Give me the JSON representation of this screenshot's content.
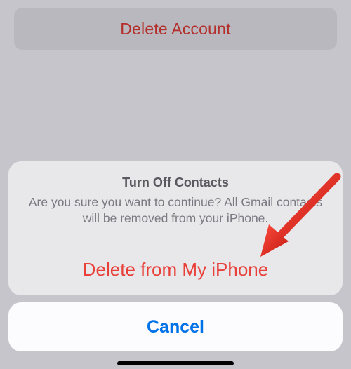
{
  "delete_account_label": "Delete Account",
  "sheet": {
    "title": "Turn Off Contacts",
    "message": "Are you sure you want to continue? All Gmail contacts will be removed from your iPhone.",
    "action_label": "Delete from My iPhone"
  },
  "cancel_label": "Cancel"
}
